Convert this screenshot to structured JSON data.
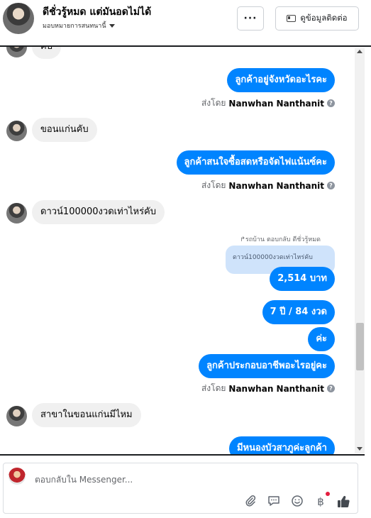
{
  "header": {
    "title": "ดีชั่วรู้หมด แต่มันอดไม่ได้",
    "assigned": "มอบหมายการสนทนานี้",
    "more_label": "···",
    "contact_label": "ดูข้อมูลติดต่อ"
  },
  "messages": {
    "cut_top": "คับ",
    "out_1": "ลูกค้าอยู่จังหวัดอะไรคะ",
    "sent_by_prefix": "ส่งโดย",
    "sent_by_name": "Nanwhan Nanthanit",
    "in_1": "ขอนแก่นคับ",
    "out_2": "ลูกค้าสนใจซื้อสดหรือจัดไฟแน้นซ์คะ",
    "in_2": "ดาวน์100000งวดเท่าไหร่คับ",
    "reply_note": "↱รถบ้าน ตอบกลับ ดีชั่วรู้หมด",
    "quoted": "ดาวน์100000งวดเท่าไหร่คับ",
    "out_3": "2,514 บาท",
    "out_4": "7 ปี / 84 งวด",
    "out_5": "ค่ะ",
    "out_6": "ลูกค้าประกอบอาชีพอะไรอยู่คะ",
    "in_3": "สาขาในขอนแก่นมีไหม",
    "out_7": "มีหนองบัวสาภูค่ะลูกค้า"
  },
  "composer": {
    "placeholder": "ตอบกลับใน Messenger..."
  },
  "icons": [
    "more-icon",
    "contact-card-icon",
    "help-icon",
    "attach-icon",
    "saved-reply-icon",
    "emoji-icon",
    "baht-icon",
    "like-icon"
  ],
  "colors": {
    "accent": "#0084ff",
    "incoming_bubble": "#f0f0f0",
    "quote_bubble": "#cfe3fb"
  }
}
